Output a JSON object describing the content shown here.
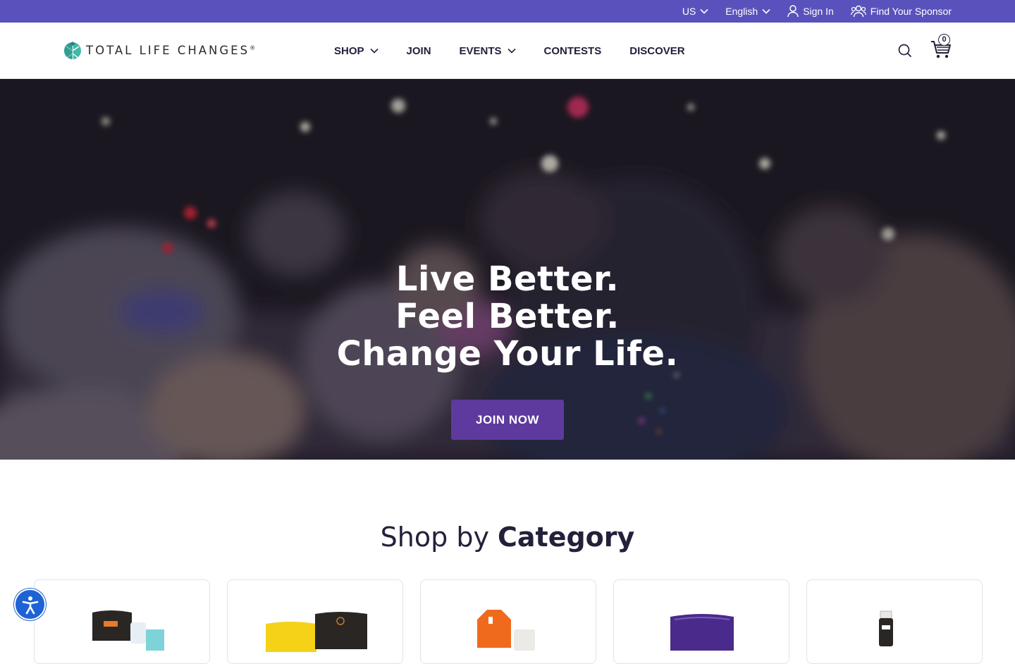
{
  "topbar": {
    "country": "US",
    "language": "English",
    "sign_in": "Sign In",
    "find_sponsor": "Find Your Sponsor"
  },
  "brand": {
    "name": "TOTAL LIFE CHANGES",
    "registered": "®"
  },
  "nav": {
    "items": [
      {
        "label": "SHOP",
        "dropdown": true
      },
      {
        "label": "JOIN",
        "dropdown": false
      },
      {
        "label": "EVENTS",
        "dropdown": true
      },
      {
        "label": "CONTESTS",
        "dropdown": false
      },
      {
        "label": "DISCOVER",
        "dropdown": false
      }
    ],
    "cart_count": "0"
  },
  "hero": {
    "line1": "Live Better.",
    "line2": "Feel Better.",
    "line3": "Change Your Life.",
    "cta": "JOIN NOW"
  },
  "category": {
    "heading_light": "Shop by ",
    "heading_bold": "Category"
  },
  "colors": {
    "topbar": "#5a52bc",
    "cta": "#5e3a9e",
    "text": "#23213a",
    "accessibility": "#1e62d6"
  },
  "icons": [
    "chevron-down-icon",
    "user-icon",
    "users-icon",
    "search-icon",
    "cart-icon",
    "accessibility-icon"
  ]
}
